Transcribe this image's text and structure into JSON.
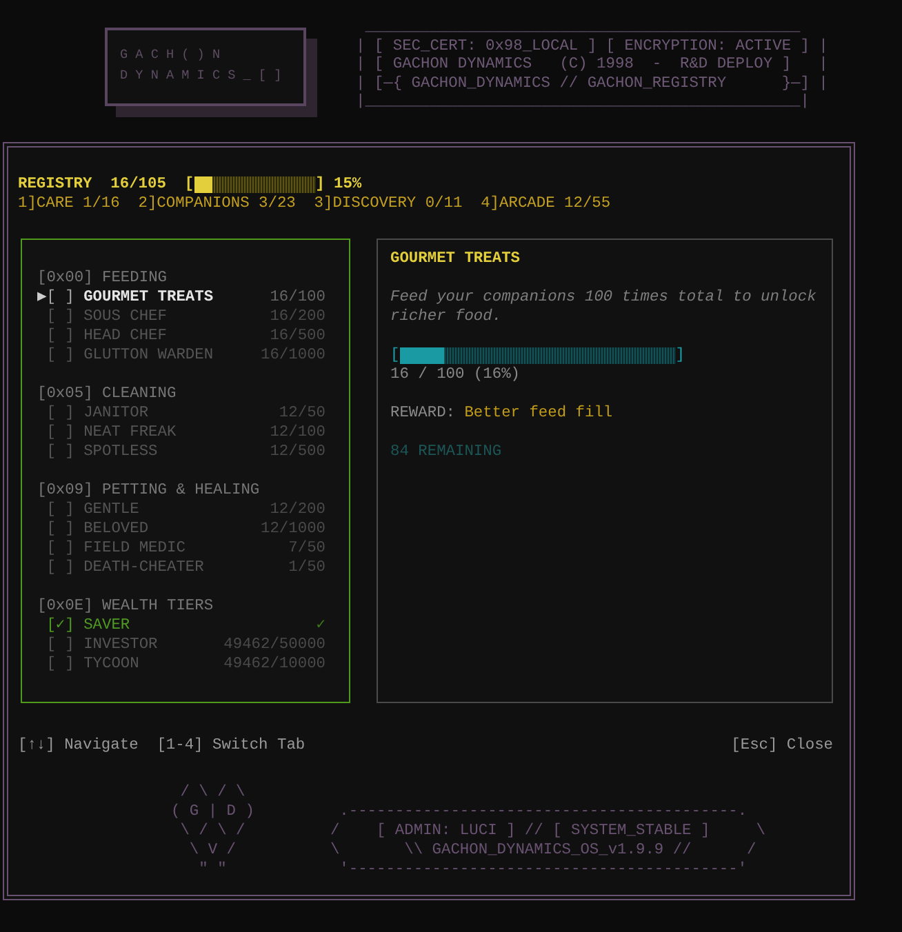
{
  "logo": {
    "lines": [
      "G A C H ( ) N",
      "D Y N A M I C S _ [ ]"
    ]
  },
  "banner": {
    "lines": [
      " _______________________________________________",
      "| [ SEC_CERT: 0x98_LOCAL ] [ ENCRYPTION: ACTIVE ] |",
      "| [ GACHON DYNAMICS   (C) 1998  -  R&D DEPLOY ]   |",
      "| [—{ GACHON_DYNAMICS // GACHON_REGISTRY      }—] |",
      "|_______________________________________________|"
    ]
  },
  "registry": {
    "label": "REGISTRY",
    "count": "16/105",
    "bar_left": "[",
    "bar_right": "]",
    "level": 0.15,
    "percent": "15%"
  },
  "tabs": [
    {
      "label": "1]CARE 1/16"
    },
    {
      "label": "2]COMPANIONS 3/23"
    },
    {
      "label": "3]DISCOVERY 0/11"
    },
    {
      "label": "4]ARCADE 12/55"
    }
  ],
  "sections": [
    {
      "header": "[0x00] FEEDING",
      "items": [
        {
          "cursor": "▶",
          "box": "[ ]",
          "name": "GOURMET TREATS",
          "progress": "16/100",
          "selected": true,
          "checked": false
        },
        {
          "box": "[ ]",
          "name": "SOUS CHEF",
          "progress": "16/200",
          "selected": false,
          "checked": false
        },
        {
          "box": "[ ]",
          "name": "HEAD CHEF",
          "progress": "16/500",
          "selected": false,
          "checked": false
        },
        {
          "box": "[ ]",
          "name": "GLUTTON WARDEN",
          "progress": "16/1000",
          "selected": false,
          "checked": false
        }
      ]
    },
    {
      "header": "[0x05] CLEANING",
      "items": [
        {
          "box": "[ ]",
          "name": "JANITOR",
          "progress": "12/50",
          "selected": false,
          "checked": false
        },
        {
          "box": "[ ]",
          "name": "NEAT FREAK",
          "progress": "12/100",
          "selected": false,
          "checked": false
        },
        {
          "box": "[ ]",
          "name": "SPOTLESS",
          "progress": "12/500",
          "selected": false,
          "checked": false
        }
      ]
    },
    {
      "header": "[0x09] PETTING & HEALING",
      "items": [
        {
          "box": "[ ]",
          "name": "GENTLE",
          "progress": "12/200",
          "selected": false,
          "checked": false
        },
        {
          "box": "[ ]",
          "name": "BELOVED",
          "progress": "12/1000",
          "selected": false,
          "checked": false
        },
        {
          "box": "[ ]",
          "name": "FIELD MEDIC",
          "progress": "7/50",
          "selected": false,
          "checked": false
        },
        {
          "box": "[ ]",
          "name": "DEATH-CHEATER",
          "progress": "1/50",
          "selected": false,
          "checked": false
        }
      ]
    },
    {
      "header": "[0x0E] WEALTH TIERS",
      "items": [
        {
          "box": "[✓]",
          "name": "SAVER",
          "progress": "✓",
          "selected": false,
          "checked": true
        },
        {
          "box": "[ ]",
          "name": "INVESTOR",
          "progress": "49462/50000",
          "selected": false,
          "checked": false
        },
        {
          "box": "[ ]",
          "name": "TYCOON",
          "progress": "49462/10000",
          "selected": false,
          "checked": false
        }
      ]
    }
  ],
  "detail": {
    "title": "GOURMET TREATS",
    "description": "Feed your companions 100 times total to unlock richer food.",
    "bar_left": "[",
    "bar_right": "]",
    "level": 0.16,
    "progress": "16 / 100 (16%)",
    "reward_label": "REWARD:",
    "reward": "Better feed fill",
    "remaining": "84 REMAINING"
  },
  "hints": {
    "left": "[↑↓] Navigate  [1-4] Switch Tab",
    "right": "[Esc] Close"
  },
  "emblem": {
    "lines": [
      " / \\ / \\",
      "( G | D )",
      " \\ / \\ /",
      "  \\ V /",
      "   \" \""
    ]
  },
  "status_banner": {
    "lines": [
      " .------------------------------------------.",
      "/    [ ADMIN: LUCI ] // [ SYSTEM_STABLE ]     \\",
      "\\       \\\\ GACHON_DYNAMICS_OS_v1.9.9 //      /",
      " '------------------------------------------'"
    ]
  }
}
